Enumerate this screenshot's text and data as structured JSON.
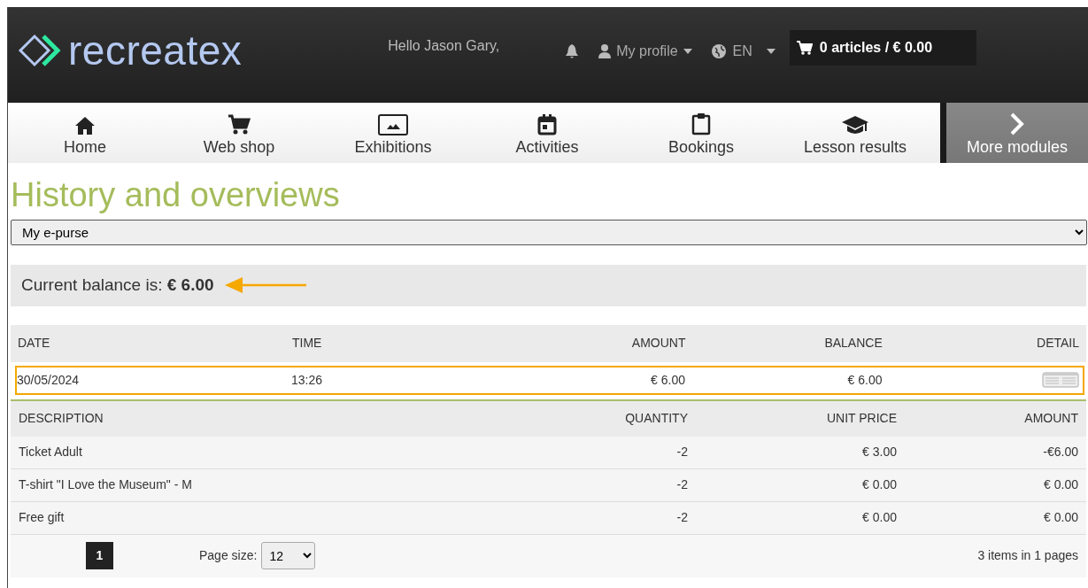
{
  "header": {
    "logo": "recreatex",
    "greeting": "Hello Jason Gary,",
    "profile": "My profile",
    "language": "EN",
    "cart": "0 articles / € 0.00"
  },
  "nav": [
    {
      "label": "Home",
      "kind": "module"
    },
    {
      "label": "Web shop",
      "kind": "module"
    },
    {
      "label": "Exhibitions",
      "kind": "module"
    },
    {
      "label": "Activities",
      "kind": "module"
    },
    {
      "label": "Bookings",
      "kind": "module"
    },
    {
      "label": "Lesson results",
      "kind": "module"
    },
    {
      "label": "More modules",
      "kind": "more"
    }
  ],
  "page_title": "History and overviews",
  "overview_select": {
    "value": "My e-purse"
  },
  "balance": {
    "text": "Current balance is: **€ 6.00**",
    "annotated": true
  },
  "transactions": {
    "columns": [
      "DATE",
      "TIME",
      "AMOUNT",
      "BALANCE",
      "DETAIL"
    ],
    "rows": [
      {
        "date": "30/05/2024",
        "time": "13:26",
        "amount": "€ 6.00",
        "balance": "€ 6.00",
        "highlighted": true
      }
    ]
  },
  "details": {
    "columns": [
      "DESCRIPTION",
      "QUANTITY",
      "UNIT PRICE",
      "AMOUNT"
    ],
    "rows": [
      {
        "description": "Ticket Adult",
        "quantity": "-2",
        "unit_price": "€ 3.00",
        "amount": "-€6.00"
      },
      {
        "description": "T-shirt \"I Love the Museum\" - M",
        "quantity": "-2",
        "unit_price": "€ 0.00",
        "amount": "€ 0.00"
      },
      {
        "description": "Free gift",
        "quantity": "-2",
        "unit_price": "€ 0.00",
        "amount": "€ 0.00"
      }
    ]
  },
  "pagination": {
    "pages": [
      {
        "label": "1",
        "selected": true
      }
    ],
    "page_size_label": "Page size:",
    "page_size": "12",
    "summary": "3 items in 1 pages"
  }
}
